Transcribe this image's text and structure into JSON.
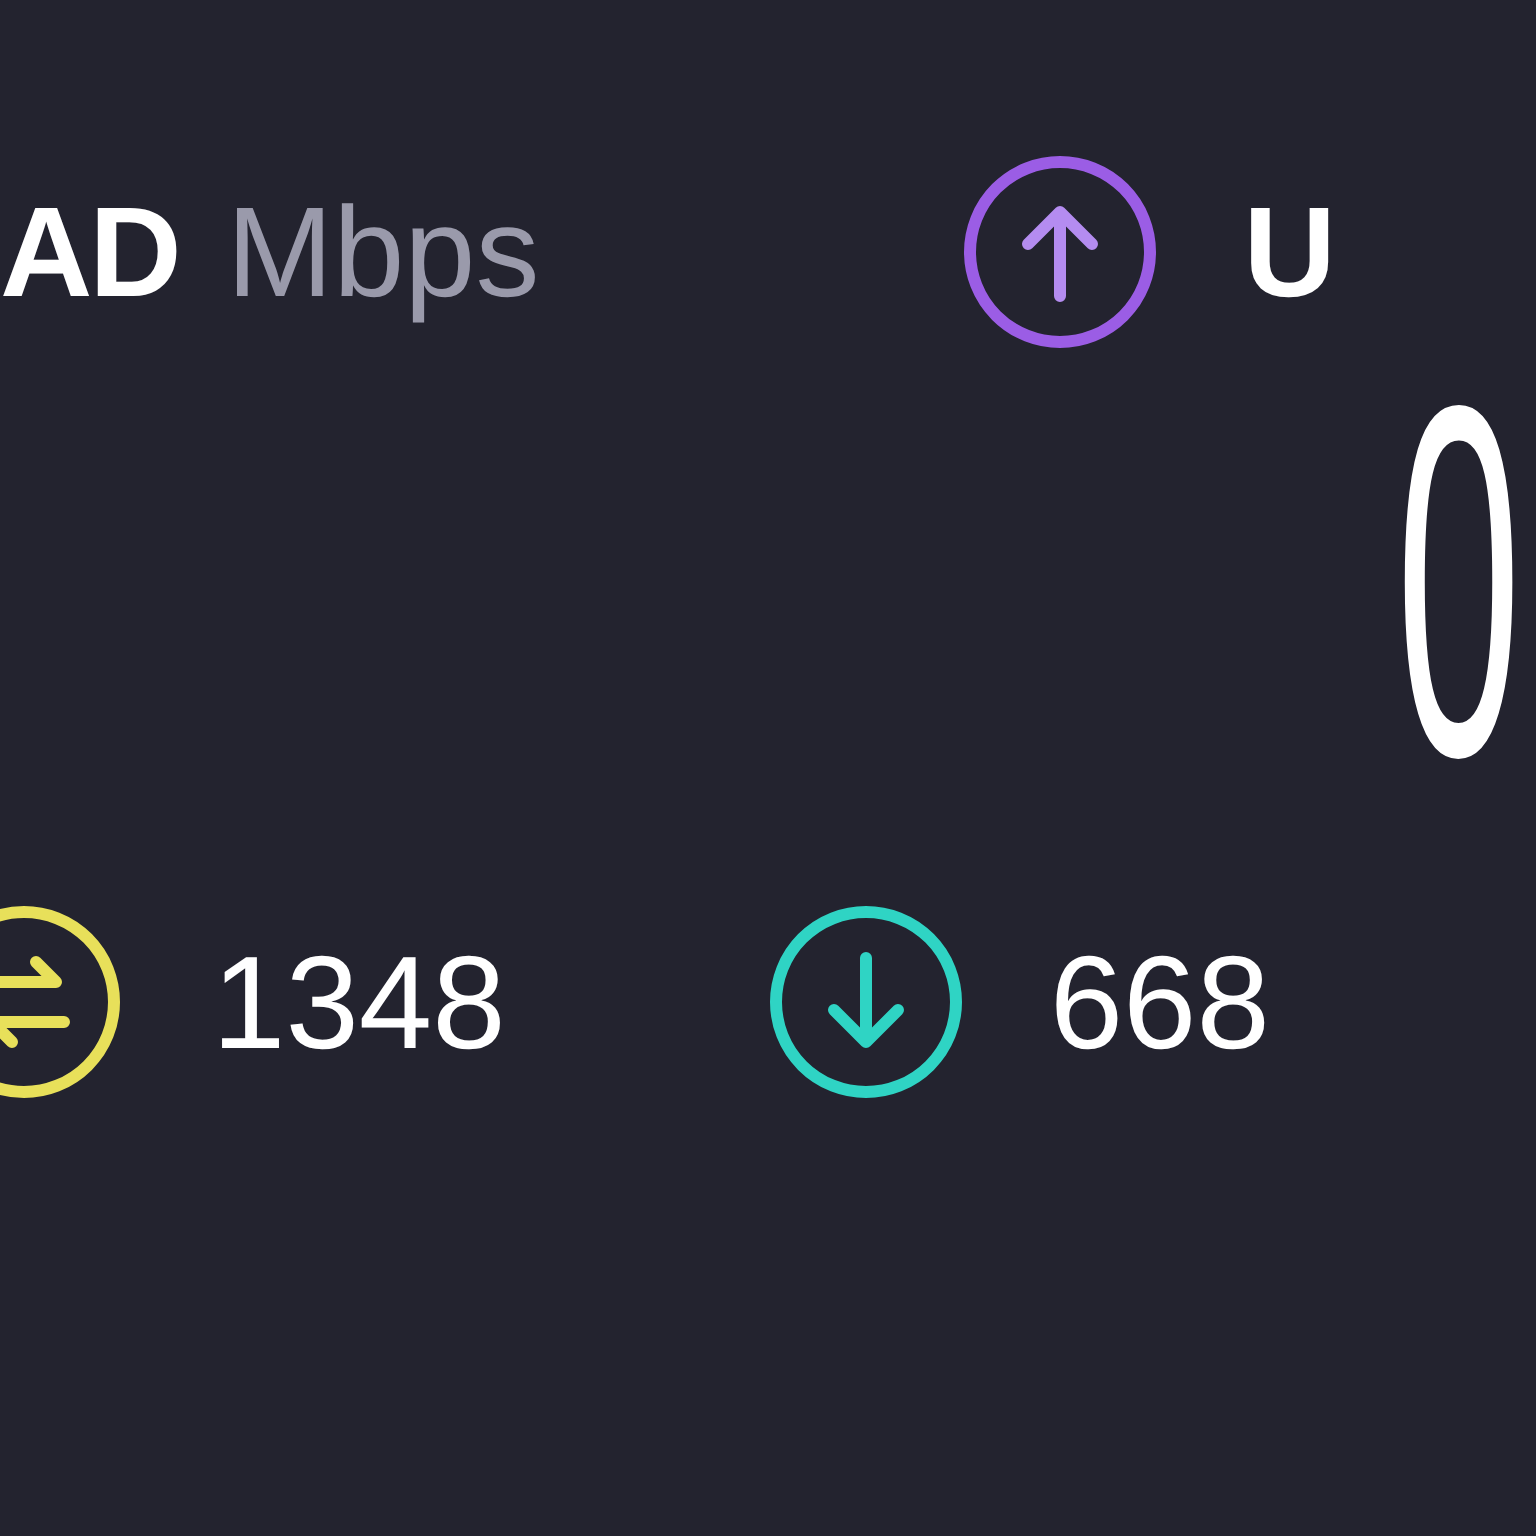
{
  "download": {
    "label": "AD",
    "unit": "Mbps"
  },
  "upload": {
    "label": "U",
    "value": "0"
  },
  "stats": [
    {
      "kind": "ping",
      "value": "1348"
    },
    {
      "kind": "download",
      "value": "668"
    }
  ]
}
